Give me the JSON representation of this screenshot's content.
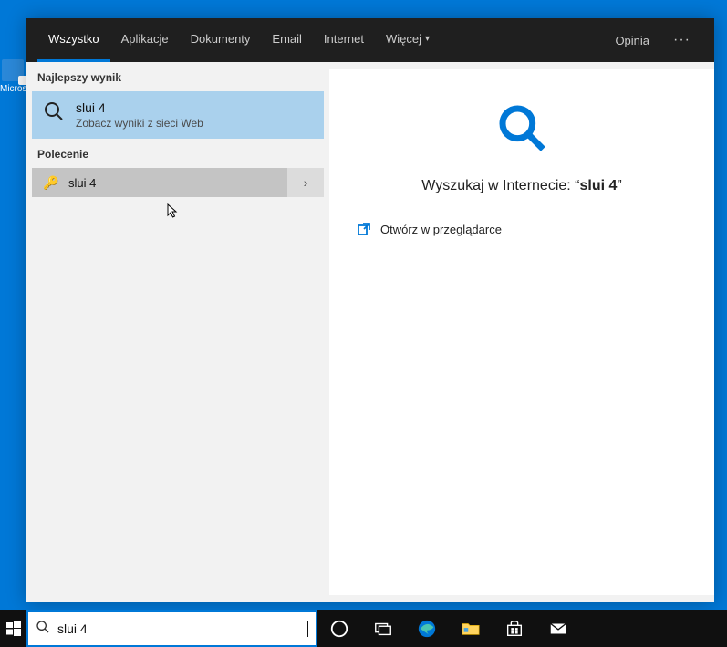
{
  "desktop": {
    "icon_label": "Micros"
  },
  "tabs": {
    "all": "Wszystko",
    "apps": "Aplikacje",
    "docs": "Dokumenty",
    "email": "Email",
    "internet": "Internet",
    "more": "Więcej",
    "feedback": "Opinia"
  },
  "left": {
    "best_header": "Najlepszy wynik",
    "best_title": "slui 4",
    "best_sub": "Zobacz wyniki z sieci Web",
    "cmd_header": "Polecenie",
    "cmd_label": "slui 4"
  },
  "right": {
    "prefix": "Wyszukaj w Internecie: “",
    "query": "slui 4",
    "suffix": "”",
    "open_browser": "Otwórz w przeglądarce"
  },
  "search": {
    "value": "slui 4"
  }
}
